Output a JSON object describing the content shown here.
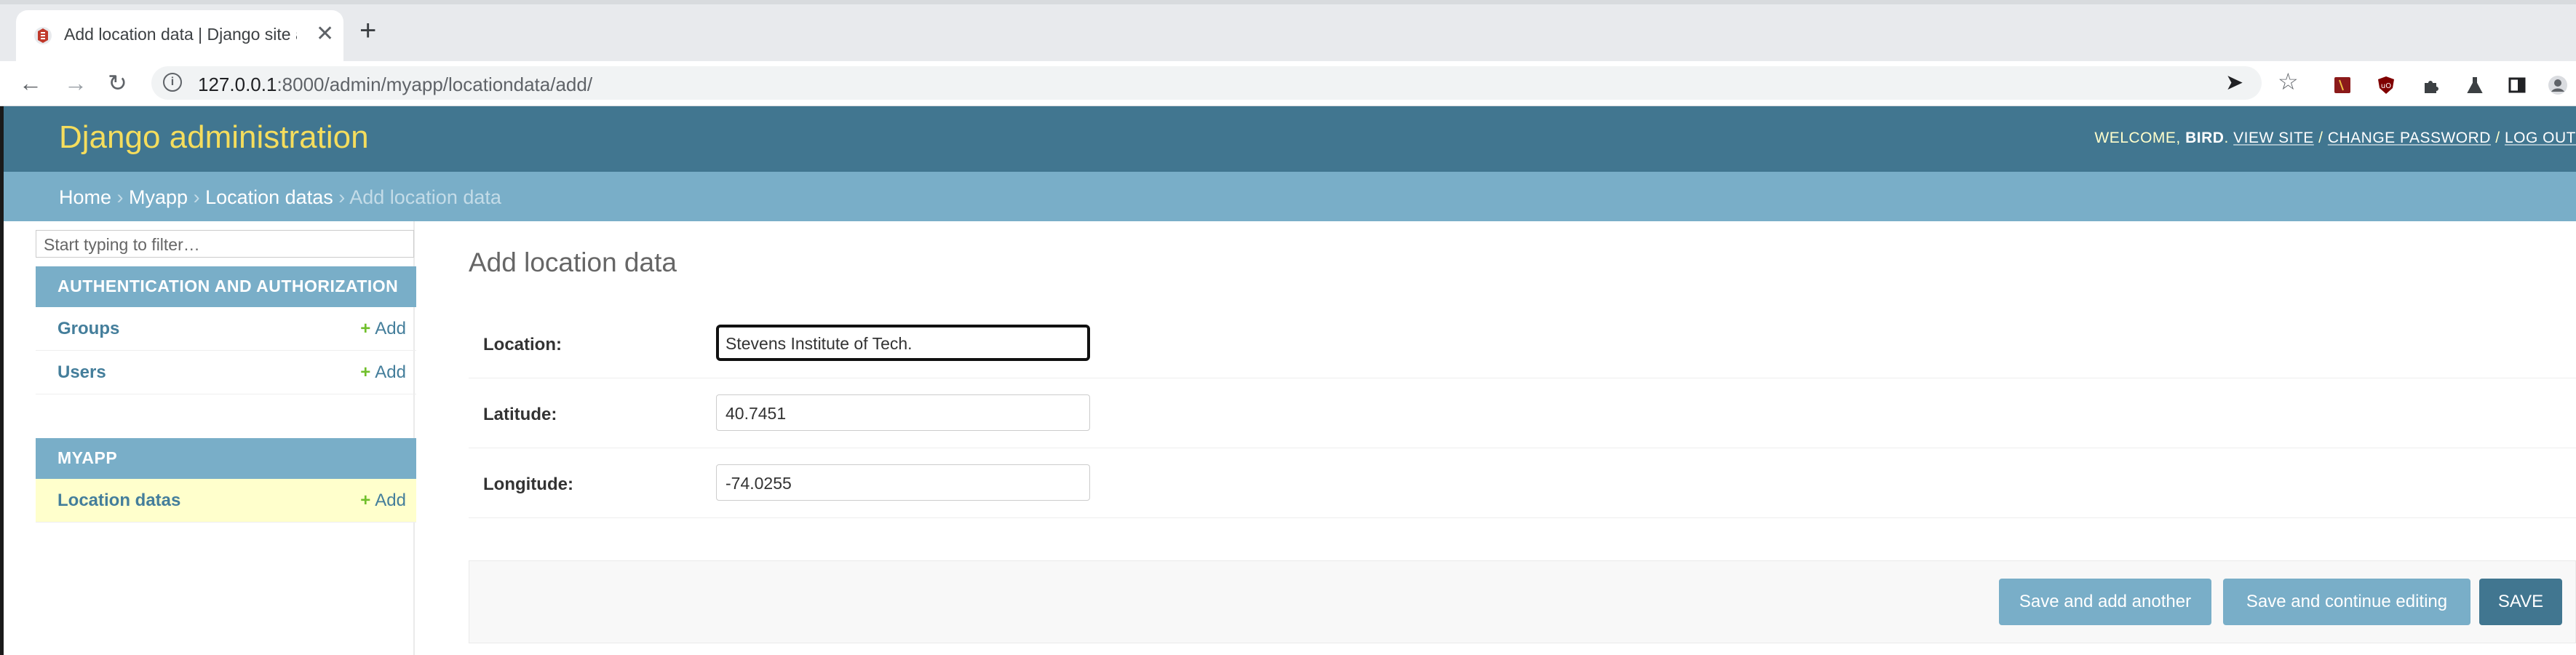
{
  "browser": {
    "tab_title": "Add location data | Django site adm",
    "url_host": "127.0.0.1",
    "url_rest": ":8000/admin/myapp/locationdata/add/"
  },
  "header": {
    "branding": "Django administration",
    "welcome": "WELCOME, ",
    "username": "BIRD",
    "view_site": "VIEW SITE",
    "change_password": "CHANGE PASSWORD",
    "log_out": "LOG OUT",
    "separator": " / "
  },
  "breadcrumbs": {
    "home": "Home",
    "app": "Myapp",
    "model": "Location datas",
    "current": "Add location data",
    "sep": " › "
  },
  "sidebar": {
    "filter_placeholder": "Start typing to filter…",
    "modules": [
      {
        "caption": "AUTHENTICATION AND AUTHORIZATION",
        "rows": [
          {
            "label": "Groups",
            "add": "Add"
          },
          {
            "label": "Users",
            "add": "Add"
          }
        ]
      },
      {
        "caption": "MYAPP",
        "rows": [
          {
            "label": "Location datas",
            "add": "Add"
          }
        ]
      }
    ]
  },
  "content": {
    "title": "Add location data",
    "fields": [
      {
        "label": "Location:",
        "value": "Stevens Institute of Tech."
      },
      {
        "label": "Latitude:",
        "value": "40.7451"
      },
      {
        "label": "Longitude:",
        "value": "-74.0255"
      }
    ],
    "buttons": {
      "save_add_another": "Save and add another",
      "save_continue": "Save and continue editing",
      "save": "SAVE"
    }
  },
  "colors": {
    "header_bg": "#417690",
    "breadcrumb_bg": "#79aec8",
    "branding": "#f5dd5d",
    "current_row_bg": "#ffffcc",
    "add_plus": "#70bf2b"
  }
}
